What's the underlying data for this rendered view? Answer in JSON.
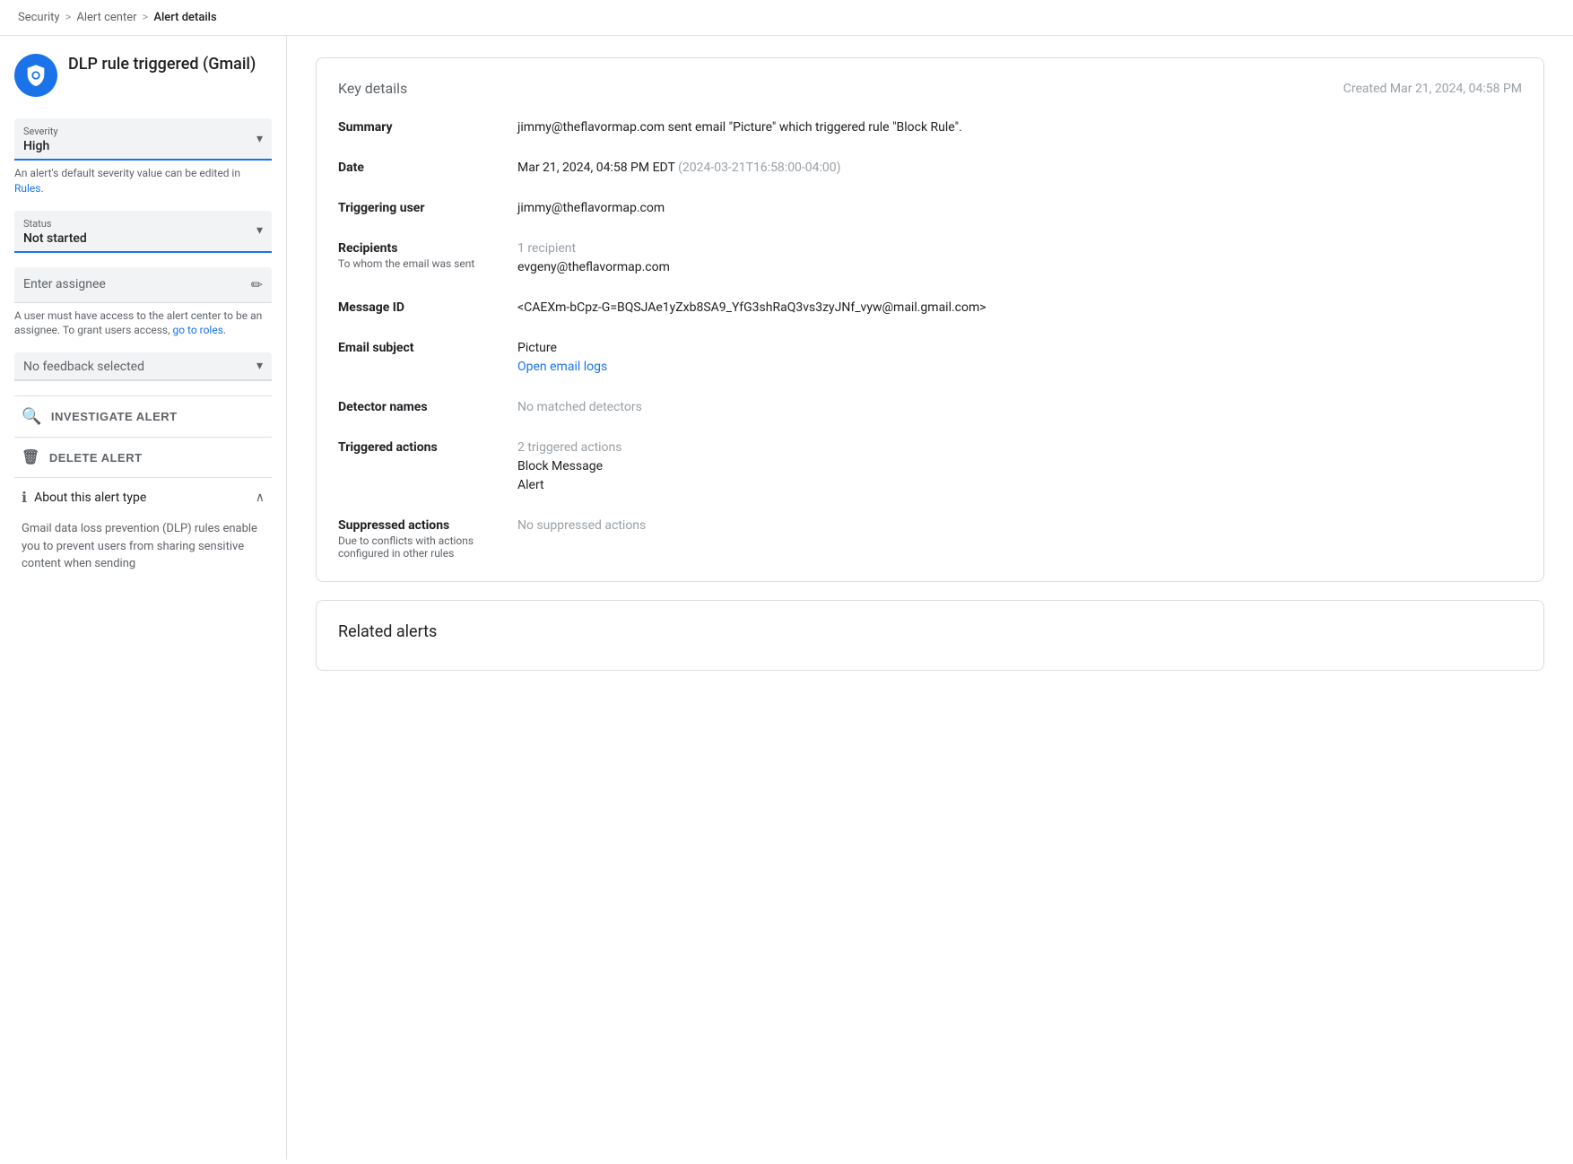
{
  "breadcrumb": {
    "items": [
      "Security",
      "Alert center",
      "Alert details"
    ],
    "separators": [
      ">",
      ">"
    ]
  },
  "sidebar": {
    "icon_label": "DLP shield icon",
    "title": "DLP rule triggered (Gmail)",
    "severity": {
      "label": "Severity",
      "value": "High"
    },
    "severity_helper": "An alert's default severity value can be edited in ",
    "severity_helper_link": "Rules",
    "severity_helper_suffix": ".",
    "status": {
      "label": "Status",
      "value": "Not started"
    },
    "assignee": {
      "placeholder": "Enter assignee"
    },
    "assignee_helper": "A user must have access to the alert center to be an assignee. To grant users access, ",
    "assignee_helper_link": "go to roles",
    "assignee_helper_suffix": ".",
    "feedback": {
      "label": "No feedback selected"
    },
    "investigate_btn": "INVESTIGATE ALERT",
    "delete_btn": "DELETE ALERT",
    "about_title": "About this alert type",
    "about_content": "Gmail data loss prevention (DLP) rules enable you to prevent users from sharing sensitive content when sending"
  },
  "main": {
    "card_title": "Key details",
    "created": "Created Mar 21, 2024, 04:58 PM",
    "fields": [
      {
        "label": "Summary",
        "sub_label": "",
        "value": "jimmy@theflavormap.com sent email \"Picture\" which triggered rule \"Block Rule\"."
      },
      {
        "label": "Date",
        "sub_label": "",
        "value": "Mar 21, 2024, 04:58 PM EDT",
        "muted": "(2024-03-21T16:58:00-04:00)"
      },
      {
        "label": "Triggering user",
        "sub_label": "",
        "value": "jimmy@theflavormap.com"
      },
      {
        "label": "Recipients",
        "sub_label": "To whom the email was sent",
        "recipients_count": "1 recipient",
        "value": "evgeny@theflavormap.com"
      },
      {
        "label": "Message ID",
        "sub_label": "",
        "value": "<CAEXm-bCpz-G=BQSJAe1yZxb8SA9_YfG3shRaQ3vs3zyJNf_vyw@mail.gmail.com>"
      },
      {
        "label": "Email subject",
        "sub_label": "",
        "value": "Picture",
        "link": "Open email logs",
        "link_href": "#"
      },
      {
        "label": "Detector names",
        "sub_label": "",
        "value_muted": "No matched detectors"
      },
      {
        "label": "Triggered actions",
        "sub_label": "",
        "actions_count": "2 triggered actions",
        "actions": [
          "Block Message",
          "Alert"
        ]
      },
      {
        "label": "Suppressed actions",
        "sub_label": "Due to conflicts with actions configured in other rules",
        "value_muted": "No suppressed actions"
      }
    ],
    "related_alerts_title": "Related alerts"
  }
}
